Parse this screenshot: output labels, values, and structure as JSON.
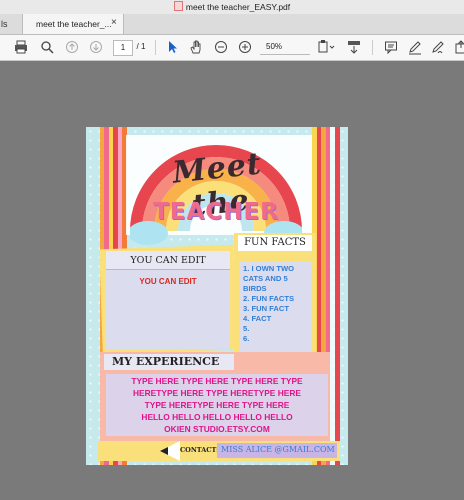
{
  "window": {
    "title": "meet the teacher_EASY.pdf"
  },
  "tabs": {
    "left_fragment": "ls",
    "active_tab": "meet the teacher_...",
    "close_glyph": "×"
  },
  "toolbar": {
    "page_current": "1",
    "page_total": "/ 1",
    "zoom": "50%",
    "icons": [
      "print-icon",
      "zoom-out-magnifier-icon",
      "page-up-icon",
      "page-down-icon",
      "pointer-icon",
      "hand-icon",
      "zoom-minus-icon",
      "zoom-plus-icon",
      "fit-page-icon",
      "scroll-mode-icon",
      "comment-icon",
      "pen-icon",
      "sign-icon",
      "share-icon"
    ]
  },
  "document": {
    "heading_meet": "Meet the",
    "heading_teacher": "TEACHER",
    "left_box": {
      "title": "YOU CAN EDIT",
      "subtitle": "YOU CAN EDIT"
    },
    "fun_facts": {
      "title": "FUN FACTS",
      "items": [
        "1.  I OWN TWO CATS AND 5 BIRDS",
        "2. FUN FACTS",
        "3. FUN FACT",
        "4. FACT",
        "5.",
        "6."
      ]
    },
    "experience": {
      "title": "MY EXPERIENCE",
      "body": [
        "TYPE HERE TYPE HERE TYPE HERE TYPE",
        "HERETYPE HERE TYPE HERETYPE HERE",
        "TYPE HERETYPE HERE TYPE HERE",
        "HELLO HELLO HELLO HELLO HELLO",
        "OKIEN STUDIO.ETSY.COM"
      ]
    },
    "contact": {
      "label": "CONTACT:",
      "value": "MISS ALICE @GMAIL.COM"
    }
  },
  "colors": {
    "accent_pink": "#e0148a",
    "accent_blue": "#2f7fd6",
    "red_text": "#d9281f",
    "page_bg": "#c5e9ec"
  }
}
